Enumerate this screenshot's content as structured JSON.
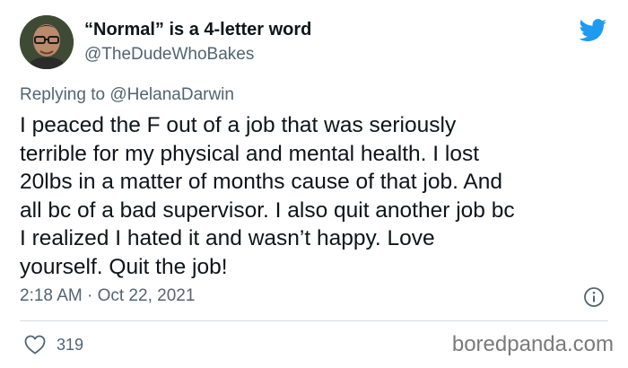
{
  "author": {
    "display_name": "“Normal” is a 4-letter word",
    "handle": "@TheDudeWhoBakes"
  },
  "reply": {
    "prefix": "Replying to ",
    "mention": "@HelanaDarwin"
  },
  "tweet": {
    "lines": [
      "I peaced the F out of a job that was seriously",
      "terrible for my physical and mental health. I lost",
      "20lbs in a matter of months cause of that job. And",
      "all bc of a bad supervisor. I also quit another job bc",
      "I realized I hated it and wasn’t happy. Love",
      "yourself. Quit the job!"
    ],
    "timestamp": "2:18 AM · Oct 22, 2021"
  },
  "actions": {
    "like_count": "319"
  },
  "watermark": "boredpanda.com",
  "colors": {
    "twitter_blue": "#1d9bf0",
    "secondary_text": "#536471",
    "primary_text": "#0f1419"
  },
  "icons": {
    "logo": "twitter-bird-icon",
    "info": "info-icon",
    "like": "heart-icon"
  }
}
